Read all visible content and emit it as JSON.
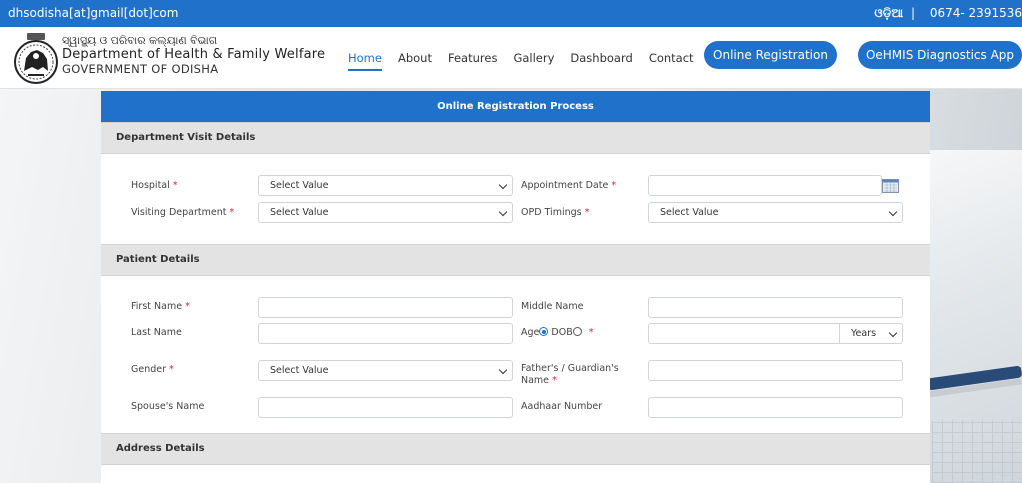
{
  "topbar": {
    "email": "dhsodisha[at]gmail[dot]com",
    "language": "ଓଡ଼ିଆ",
    "separator": "|",
    "phone": "0674- 2391536"
  },
  "header": {
    "dept_odia": "ସ୍ୱାସ୍ଥ୍ୟ ଓ ପରିବାର କଲ୍ୟାଣ ବିଭାଗ",
    "dept_name": "Department of Health & Family Welfare",
    "government": "GOVERNMENT OF ODISHA"
  },
  "nav": {
    "items": [
      "Home",
      "About",
      "Features",
      "Gallery",
      "Dashboard",
      "Contact"
    ],
    "active": "Home"
  },
  "buttons": {
    "online_registration": "Online Registration",
    "diagnostics_app": "OeHMIS Diagnostics App"
  },
  "form": {
    "title": "Online Registration Process",
    "sections": {
      "department_visit": "Department Visit Details",
      "patient": "Patient Details",
      "address": "Address Details"
    },
    "required_marker": "*",
    "labels": {
      "hospital": "Hospital",
      "visiting_department": "Visiting Department",
      "appointment_date": "Appointment Date",
      "opd_timings": "OPD Timings",
      "first_name": "First Name",
      "middle_name": "Middle Name",
      "last_name": "Last Name",
      "age": "Age",
      "dob": "DOB",
      "gender": "Gender",
      "guardian_name_line1": "Father's / Guardian's",
      "guardian_name_line2": "Name",
      "spouse_name": "Spouse's Name",
      "aadhaar_number": "Aadhaar Number"
    },
    "values": {
      "hospital": "Select Value",
      "visiting_department": "Select Value",
      "appointment_date": "",
      "opd_timings": "Select Value",
      "first_name": "",
      "middle_name": "",
      "last_name": "",
      "age": "",
      "age_unit": "Years",
      "gender": "Select Value",
      "guardian_name": "",
      "spouse_name": "",
      "aadhaar_number": ""
    },
    "age_mode_selected": "Age"
  },
  "colors": {
    "primary": "#1f71c9",
    "required": "#d9262b",
    "section_bg": "#e3e3e3"
  },
  "icons": {
    "emblem": "odisha-emblem-icon",
    "calendar": "calendar-icon",
    "dropdown": "chevron-down-icon"
  }
}
